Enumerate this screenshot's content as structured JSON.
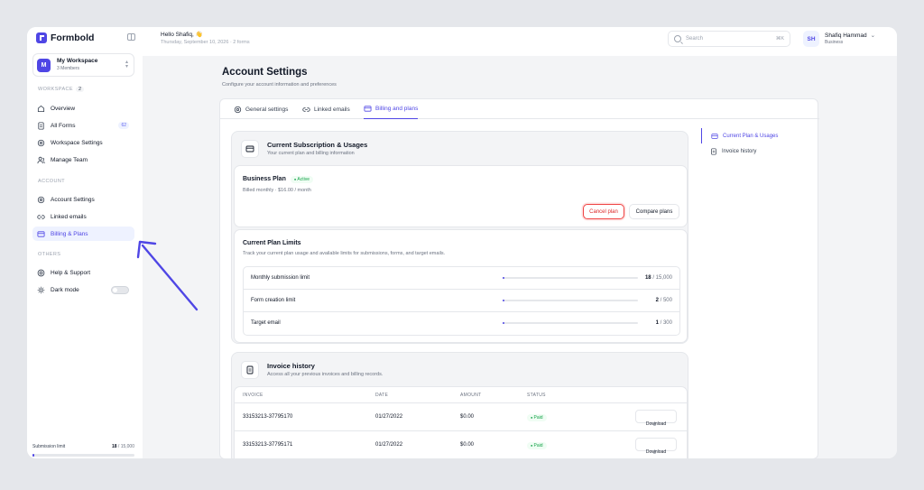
{
  "brand": {
    "name": "Formbold",
    "color": "#4f46e5"
  },
  "workspace": {
    "initial": "M",
    "name": "My Workspace",
    "members": "3 Members"
  },
  "sidebar": {
    "workspace_label": "WORKSPACE",
    "workspace_count": "2",
    "workspace_items": [
      {
        "label": "Overview",
        "icon": "home-icon"
      },
      {
        "label": "All Forms",
        "icon": "document-icon",
        "count": "62"
      },
      {
        "label": "Workspace Settings",
        "icon": "gear-icon"
      },
      {
        "label": "Manage Team",
        "icon": "users-icon"
      }
    ],
    "account_label": "ACCOUNT",
    "account_items": [
      {
        "label": "Account Settings",
        "icon": "gear-icon"
      },
      {
        "label": "Linked emails",
        "icon": "link-icon"
      },
      {
        "label": "Billing & Plans",
        "icon": "credit-card-icon",
        "active": true
      }
    ],
    "others_label": "OTHERS",
    "others_items": [
      {
        "label": "Help & Support",
        "icon": "support-icon"
      },
      {
        "label": "Dark mode",
        "icon": "sun-icon",
        "toggle": false
      }
    ],
    "submission": {
      "label": "Submission limit",
      "used": "18",
      "total": "/ 15,000",
      "fraction": 0.0012
    }
  },
  "header": {
    "greeting": "Hello Shafiq, 👋",
    "subline": "Thursday, September 10, 2026 · 2 forms",
    "search_placeholder": "Search",
    "search_shortcut": "⌘K",
    "user_initials": "SH",
    "user_name": "Shafiq Hammad",
    "user_role": "Business"
  },
  "page": {
    "title": "Account Settings",
    "subtitle": "Configure your account information and preferences",
    "tabs": [
      {
        "label": "General settings",
        "icon": "gear-icon"
      },
      {
        "label": "Linked emails",
        "icon": "link-icon"
      },
      {
        "label": "Billing and plans",
        "icon": "credit-card-icon",
        "active": true
      }
    ]
  },
  "subscription": {
    "title": "Current Subscription & Usages",
    "subtitle": "Your current plan and billing information",
    "plan_name": "Business Plan",
    "plan_status": "Active",
    "billing": "Billed monthly · $16.00 / month",
    "cancel_label": "Cancel plan",
    "compare_label": "Compare plans"
  },
  "limits": {
    "title": "Current Plan Limits",
    "subtitle": "Track your current plan usage and available limits for submissions, forms, and target emails.",
    "rows": [
      {
        "name": "Monthly submission limit",
        "used": "18",
        "total": "/ 15,000",
        "fraction": 0.0012
      },
      {
        "name": "Form creation limit",
        "used": "2",
        "total": "/ 500",
        "fraction": 0.004
      },
      {
        "name": "Target email",
        "used": "1",
        "total": "/ 300",
        "fraction": 0.0033
      }
    ]
  },
  "invoice": {
    "title": "Invoice history",
    "subtitle": "Access all your previous invoices and billing records.",
    "columns": [
      "INVOICE",
      "DATE",
      "AMOUNT",
      "STATUS"
    ],
    "rows": [
      {
        "invoice": "33153213-37795170",
        "date": "01/27/2022",
        "amount": "$0.00",
        "status": "Paid",
        "action": "Download"
      },
      {
        "invoice": "33153213-37795171",
        "date": "01/27/2022",
        "amount": "$0.00",
        "status": "Paid",
        "action": "Download"
      }
    ]
  },
  "right_nav": [
    {
      "label": "Current Plan & Usages",
      "icon": "credit-card-icon",
      "active": true
    },
    {
      "label": "Invoice history",
      "icon": "document-icon"
    }
  ],
  "colors": {
    "accent": "#4f46e5",
    "success": "#16a34a",
    "danger": "#dc2626",
    "annotation_arrow": "#4f46e5"
  }
}
